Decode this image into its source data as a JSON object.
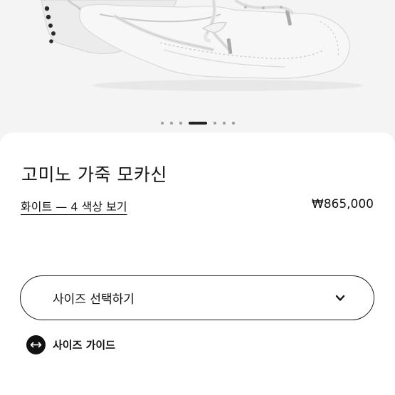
{
  "product": {
    "title": "고미노 가죽 모카신",
    "color_link": "화이트 — 4 색상 보기",
    "price": "₩865,000"
  },
  "gallery": {
    "image_icon": "white-moccasin-shoes-photo",
    "slide_count": 7,
    "active_slide_index": 3
  },
  "size_selector": {
    "label": "사이즈 선택하기",
    "icon": "chevron-down-icon"
  },
  "size_guide": {
    "label": "사이즈 가이드",
    "icon": "horizontal-arrows-icon"
  },
  "colors": {
    "text": "#111111",
    "background": "#ffffff",
    "hero_background": "#f4f4f4"
  }
}
